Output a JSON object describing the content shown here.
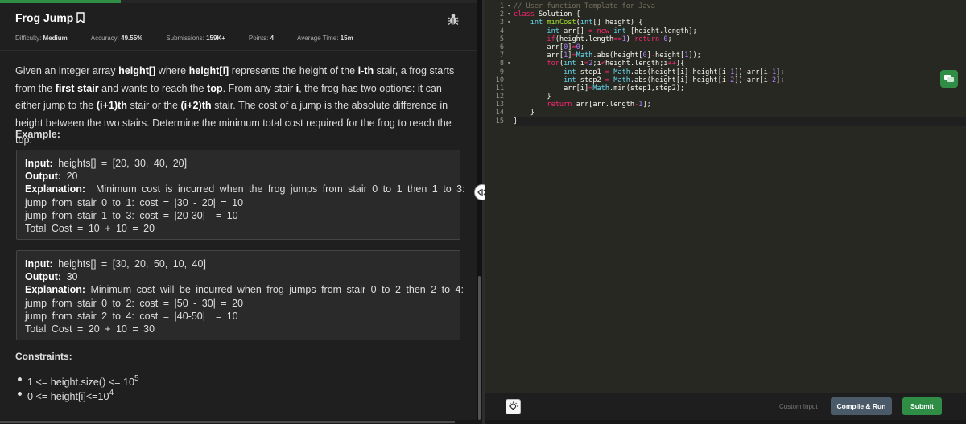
{
  "problem": {
    "title": "Frog Jump",
    "meta": {
      "difficulty_label": "Difficulty:",
      "difficulty_value": "Medium",
      "accuracy_label": "Accuracy:",
      "accuracy_value": "49.55%",
      "submissions_label": "Submissions:",
      "submissions_value": "159K+",
      "points_label": "Points:",
      "points_value": "4",
      "avg_time_label": "Average Time:",
      "avg_time_value": "15m"
    },
    "description": {
      "p1": "Given an integer array ",
      "b1": "height[]",
      "p2": " where ",
      "b2": "height[i]",
      "p3": " represents the height of the ",
      "b3": "i-th",
      "p4": " stair, a frog starts from the ",
      "b4": "first stair",
      "p5": " and wants to reach the ",
      "b5": "top",
      "p6": ". From any stair ",
      "b6": "i",
      "p7": ", the frog has two options: it can either jump to the ",
      "b7": "(i+1)th",
      "p8": " stair or the ",
      "b8": "(i+2)th",
      "p9": " stair. The cost of a jump is the absolute difference in height between the two stairs. Determine the minimum total cost required for the frog to reach the top."
    },
    "example_heading": "Example:",
    "examples": [
      {
        "input_label": "Input:",
        "input_value": " heights[] = [20, 30, 40, 20]",
        "output_label": "Output:",
        "output_value": " 20",
        "explanation_label": "Explanation:",
        "explanation_value": "  Minimum cost is incurred when the frog jumps from stair 0 to 1 then 1 to 3:",
        "lines": [
          "jump from stair 0 to 1: cost = |30 - 20| = 10",
          "jump from stair 1 to 3: cost = |20-30|  = 10",
          "Total Cost = 10 + 10 = 20"
        ]
      },
      {
        "input_label": "Input:",
        "input_value": " heights[] = [30, 20, 50, 10, 40]",
        "output_label": "Output:",
        "output_value": " 30",
        "explanation_label": "Explanation:",
        "explanation_value": " Minimum cost will be incurred when frog jumps from stair 0 to 2 then 2 to 4:",
        "lines": [
          "jump from stair 0 to 2: cost = |50 - 30| = 20",
          "jump from stair 2 to 4: cost = |40-50|  = 10",
          "Total Cost = 20 + 10 = 30"
        ]
      }
    ],
    "constraints_heading": "Constraints:",
    "constraints": [
      {
        "text": "1 <= height.size() <= 10",
        "sup": "5"
      },
      {
        "text": "0 <= height[i]<=10",
        "sup": "4"
      }
    ]
  },
  "editor": {
    "line_numbers": [
      "1",
      "2",
      "3",
      "4",
      "5",
      "6",
      "7",
      "8",
      "9",
      "10",
      "11",
      "12",
      "13",
      "14",
      "15"
    ],
    "code_lines": [
      "// User function Template for Java",
      "class Solution {",
      "    int minCost(int[] height) {",
      "        int arr[] = new int [height.length];",
      "        if(height.length==1) return 0;",
      "        arr[0]=0;",
      "        arr[1]=Math.abs(height[0]-height[1]);",
      "        for(int i=2;i<height.length;i++){",
      "            int step1 = Math.abs(height[i]-height[i-1])+arr[i-1];",
      "            int step2 = Math.abs(height[i]-height[i-2])+arr[i-2];",
      "            arr[i]=Math.min(step1,step2);",
      "        }",
      "        return arr[arr.length-1];",
      "    }",
      "}"
    ]
  },
  "actions": {
    "custom_input": "Custom Input",
    "compile_run": "Compile & Run",
    "submit": "Submit"
  },
  "colors": {
    "accent_green": "#2f8d46",
    "compile_button": "#4b5a69",
    "editor_bg": "#272822"
  },
  "icons": [
    "bookmark-icon",
    "bug-icon",
    "drag-handle-icon",
    "chat-icon",
    "bulb-icon"
  ]
}
